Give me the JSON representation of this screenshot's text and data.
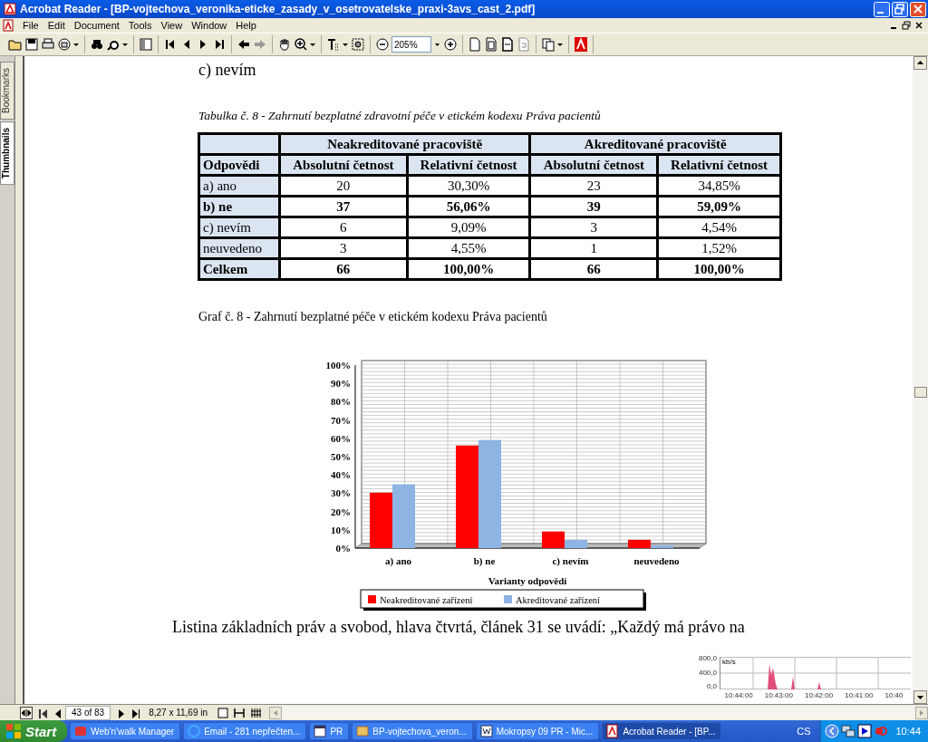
{
  "window": {
    "title": "Acrobat Reader - [BP-vojtechova_veronika-eticke_zasady_v_osetrovatelske_praxi-3avs_cast_2.pdf]"
  },
  "menu": [
    "File",
    "Edit",
    "Document",
    "Tools",
    "View",
    "Window",
    "Help"
  ],
  "toolbar": {
    "zoom_value": "205%"
  },
  "side_tabs": [
    {
      "label": "Bookmarks",
      "selected": false
    },
    {
      "label": "Thumbnails",
      "selected": true
    }
  ],
  "document": {
    "top_line": "c)  nevím",
    "table_caption": "Tabulka č. 8 -  Zahrnutí bezplatné zdravotní péče v etickém kodexu Práva pacientů",
    "table": {
      "groups": [
        "Neakreditované pracoviště",
        "Akreditované pracoviště"
      ],
      "columns": [
        "Odpovědi",
        "Absolutní četnost",
        "Relativní četnost",
        "Absolutní četnost",
        "Relativní četnost"
      ],
      "rows": [
        {
          "bold": false,
          "cells": [
            "a) ano",
            "20",
            "30,30%",
            "23",
            "34,85%"
          ]
        },
        {
          "bold": true,
          "cells": [
            "b) ne",
            "37",
            "56,06%",
            "39",
            "59,09%"
          ]
        },
        {
          "bold": false,
          "cells": [
            "c) nevím",
            "6",
            "9,09%",
            "3",
            "4,54%"
          ]
        },
        {
          "bold": false,
          "cells": [
            "neuvedeno",
            "3",
            "4,55%",
            "1",
            "1,52%"
          ]
        },
        {
          "bold": true,
          "cells": [
            "Celkem",
            "66",
            "100,00%",
            "66",
            "100,00%"
          ]
        }
      ]
    },
    "chart_caption": "Graf č. 8 - Zahrnutí bezplatné péče v etickém kodexu Práva pacientů",
    "chart_data": {
      "type": "bar",
      "xlabel": "Varianty odpovědí",
      "categories": [
        "a) ano",
        "b) ne",
        "c) nevím",
        "neuvedeno"
      ],
      "series": [
        {
          "name": "Neakreditované zařízení",
          "color": "#ff0000",
          "values": [
            30.3,
            56.06,
            9.09,
            4.55
          ]
        },
        {
          "name": "Akreditované zařízení",
          "color": "#8db4e2",
          "values": [
            34.85,
            59.09,
            4.54,
            1.52
          ]
        }
      ],
      "ylim": [
        0,
        100
      ],
      "grid": true,
      "legend": true,
      "yticks": [
        {
          "value": 0,
          "label": "0%"
        },
        {
          "value": 10,
          "label": "10%"
        },
        {
          "value": 20,
          "label": "20%"
        },
        {
          "value": 30,
          "label": "30%"
        },
        {
          "value": 40,
          "label": "40%"
        },
        {
          "value": 50,
          "label": "50%"
        },
        {
          "value": 60,
          "label": "60%"
        },
        {
          "value": 70,
          "label": "70%"
        },
        {
          "value": 80,
          "label": "80%"
        },
        {
          "value": 90,
          "label": "90%"
        },
        {
          "value": 100,
          "label": "100%"
        }
      ]
    },
    "bottom_line": "Listina základních práv a svobod, hlava čtvrtá, článek 31 se uvádí: „Každý má právo na"
  },
  "network_monitor": {
    "unit": "kb/s",
    "scale": [
      "800,0",
      "400,0",
      "0,0"
    ],
    "times": [
      "10:44:00",
      "10:43:00",
      "10:42:00",
      "10:41:00",
      "10:40"
    ]
  },
  "nav_bar": {
    "page": "43 of 83",
    "page_size": "8,27 x 11,69 in"
  },
  "taskbar": {
    "start": "Start",
    "tasks": [
      {
        "label": "Web'n'walk Manager",
        "selected": false
      },
      {
        "label": "Email - 281 nepřečten...",
        "selected": false
      },
      {
        "label": "PR",
        "selected": false
      },
      {
        "label": "BP-vojtechova_veron...",
        "selected": false
      },
      {
        "label": "Mokropsy 09 PR - Mic...",
        "selected": false
      },
      {
        "label": "Acrobat Reader - [BP...",
        "selected": true
      }
    ],
    "language": "CS",
    "clock": "10:44"
  }
}
